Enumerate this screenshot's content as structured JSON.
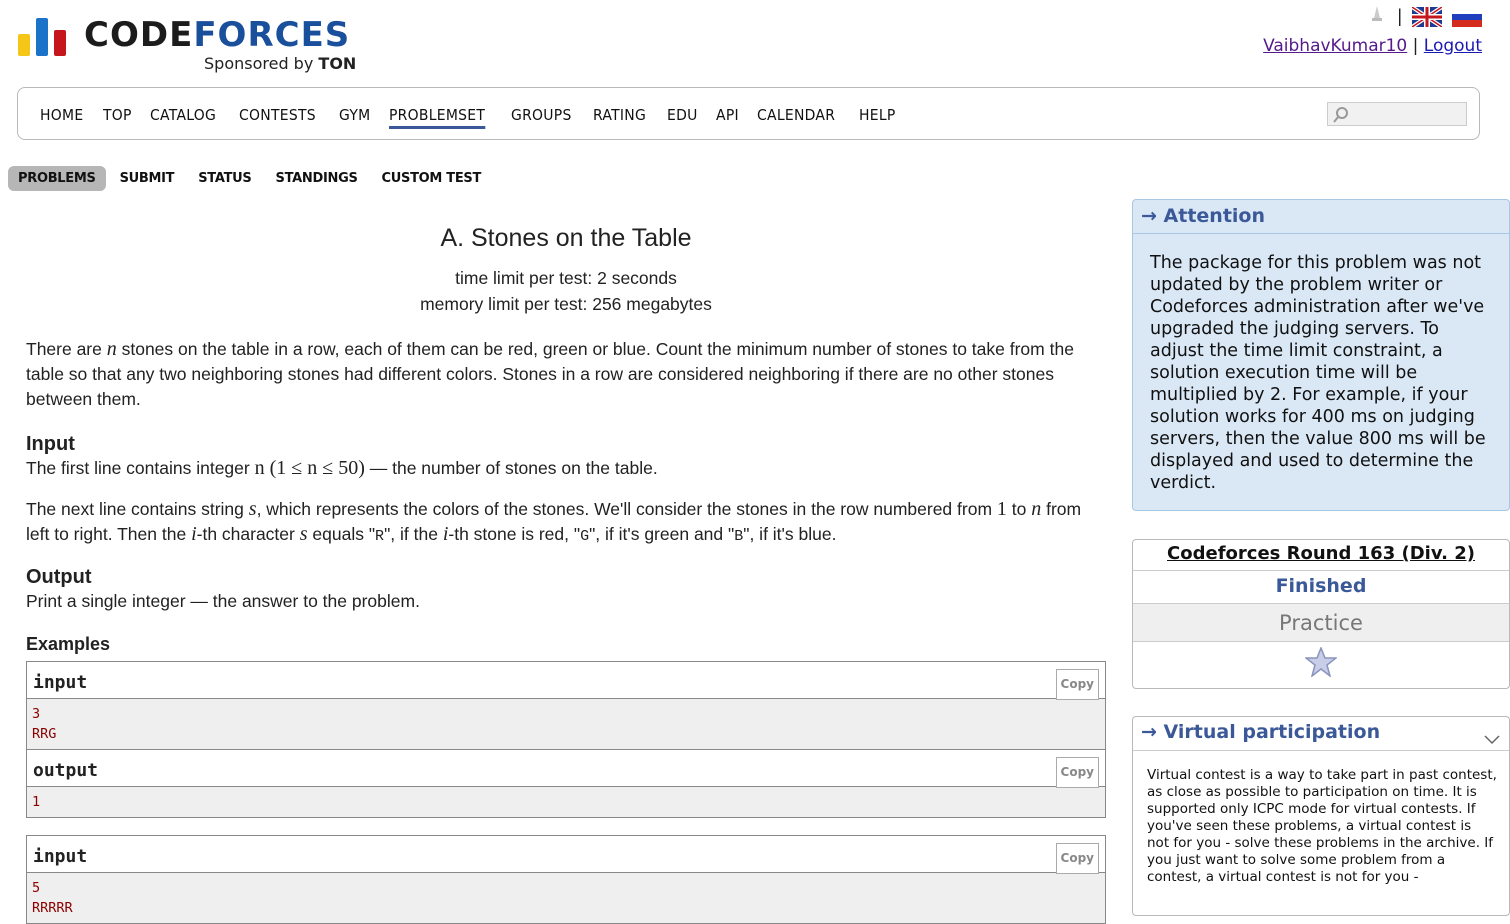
{
  "header": {
    "logo_word_code": "CODE",
    "logo_word_forces": "FORCES",
    "sponsor_prefix": "Sponsored by",
    "sponsor_name": "TON",
    "separator": "|",
    "username": "VaibhavKumar10",
    "logout": "Logout",
    "logo_colors": [
      "#f5c518",
      "#1a73c8",
      "#c4161c"
    ]
  },
  "menu": {
    "items": [
      "HOME",
      "TOP",
      "CATALOG",
      "CONTESTS",
      "GYM",
      "PROBLEMSET",
      "GROUPS",
      "RATING",
      "EDU",
      "API",
      "CALENDAR",
      "HELP"
    ],
    "active": "PROBLEMSET",
    "search_value": ""
  },
  "subtabs": {
    "items": [
      "PROBLEMS",
      "SUBMIT",
      "STATUS",
      "STANDINGS",
      "CUSTOM TEST"
    ],
    "active": "PROBLEMS"
  },
  "problem": {
    "title": "A. Stones on the Table",
    "time_limit": "time limit per test: 2 seconds",
    "memory_limit": "memory limit per test: 256 megabytes",
    "statement_a": "There are ",
    "statement_var": "n",
    "statement_b": " stones on the table in a row, each of them can be red, green or blue. Count the minimum number of stones to take from the table so that any two neighboring stones had different colors. Stones in a row are considered neighboring if there are no other stones between them.",
    "input_heading": "Input",
    "input_line1_a": "The first line contains integer ",
    "input_line1_math": "n (1 ≤ n ≤ 50)",
    "input_line1_b": " — the number of stones on the table.",
    "input_line2_a": "The next line contains string ",
    "input_line2_s": "s",
    "input_line2_b": ", which represents the colors of the stones. We'll consider the stones in the row numbered from ",
    "input_line2_one": "1",
    "input_line2_to": " to ",
    "input_line2_n": "n",
    "input_line2_c": " from left to right. Then the ",
    "input_line2_i": "i",
    "input_line2_d": "-th character ",
    "input_line2_s2": "s",
    "input_line2_e": " equals \"",
    "input_line2_R": "R",
    "input_line2_f": "\", if the ",
    "input_line2_i2": "i",
    "input_line2_g": "-th stone is red, \"",
    "input_line2_G": "G",
    "input_line2_h": "\", if it's green and \"",
    "input_line2_B": "B",
    "input_line2_k": "\", if it's blue.",
    "output_heading": "Output",
    "output_text": "Print a single integer — the answer to the problem.",
    "examples_heading": "Examples",
    "copy_label": "Copy",
    "input_label": "input",
    "output_label": "output",
    "example1_input": "3\nRRG",
    "example1_output": "1",
    "example2_input": "5\nRRRRR"
  },
  "sidebar": {
    "attention_title": "→ Attention",
    "attention_text": "The package for this problem was not updated by the problem writer or Codeforces administration after we've upgraded the judging servers. To adjust the time limit constraint, a solution execution time will be multiplied by 2. For example, if your solution works for 400 ms on judging servers, then the value 800 ms will be displayed and used to determine the verdict.",
    "round_name": "Codeforces Round 163 (Div. 2)",
    "round_status": "Finished",
    "round_mode": "Practice",
    "virtual_title": "→ Virtual participation",
    "virtual_text": "Virtual contest is a way to take part in past contest, as close as possible to participation on time. It is supported only ICPC mode for virtual contests. If you've seen these problems, a virtual contest is not for you - solve these problems in the archive. If you just want to solve some problem from a contest, a virtual contest is not for you -"
  }
}
